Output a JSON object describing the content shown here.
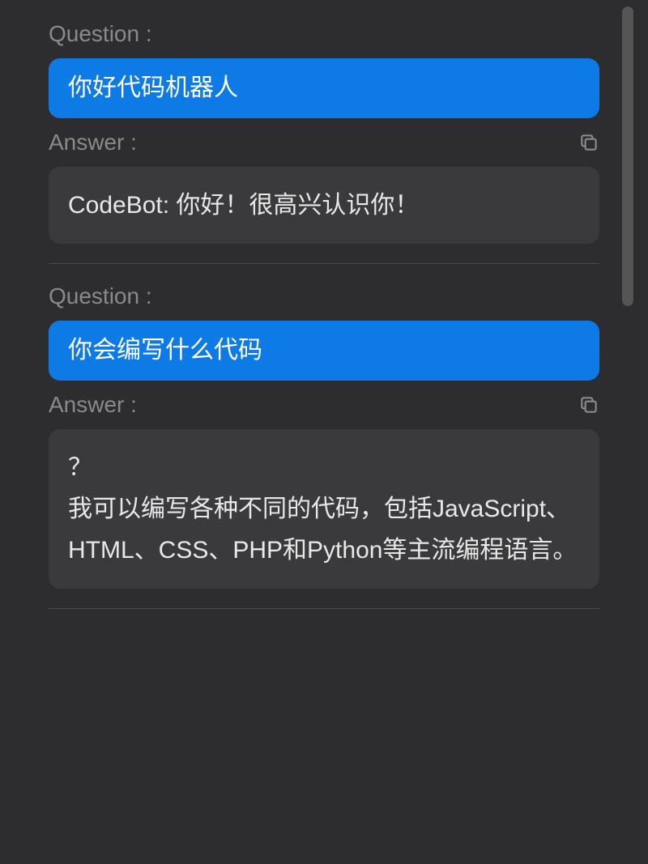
{
  "conversations": [
    {
      "question_label": "Question :",
      "question_text": "你好代码机器人",
      "answer_label": "Answer :",
      "answer_text": "CodeBot: 你好！很高兴认识你！"
    },
    {
      "question_label": "Question :",
      "question_text": "你会编写什么代码",
      "answer_label": "Answer :",
      "answer_text": "？\n我可以编写各种不同的代码，包括JavaScript、HTML、CSS、PHP和Python等主流编程语言。"
    }
  ]
}
